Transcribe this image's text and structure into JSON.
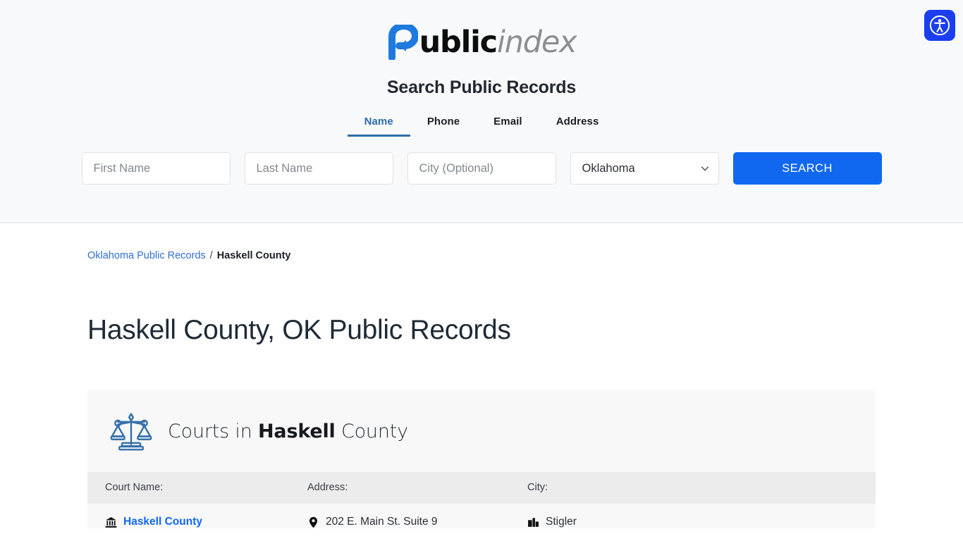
{
  "brand": {
    "name_bold": "ublic",
    "name_italic": "index",
    "logo_icon": "public-index-logo-mark",
    "accent_color": "#1168f0"
  },
  "accessibility": {
    "icon": "accessibility-person-icon",
    "label": "Accessibility options",
    "color": "#1a3ef0"
  },
  "search_panel": {
    "title": "Search Public Records",
    "tabs": [
      {
        "label": "Name",
        "active": true
      },
      {
        "label": "Phone",
        "active": false
      },
      {
        "label": "Email",
        "active": false
      },
      {
        "label": "Address",
        "active": false
      }
    ],
    "fields": {
      "first_name": {
        "placeholder": "First Name",
        "value": ""
      },
      "last_name": {
        "placeholder": "Last Name",
        "value": ""
      },
      "city": {
        "placeholder": "City (Optional)",
        "value": ""
      },
      "state": {
        "value": "Oklahoma",
        "options": [
          "Oklahoma"
        ],
        "chevron_icon": "chevron-down-icon"
      }
    },
    "search_button": "SEARCH"
  },
  "breadcrumb": {
    "parent": "Oklahoma Public Records",
    "separator": "/",
    "current": "Haskell County"
  },
  "page": {
    "title": "Haskell County, OK Public Records"
  },
  "courts_card": {
    "icon": "scales-of-justice-icon",
    "title_prefix": "Courts in ",
    "title_emphasis": "Haskell",
    "title_suffix": " County",
    "columns": [
      {
        "header": "Court Name:"
      },
      {
        "header": "Address:"
      },
      {
        "header": "City:"
      }
    ],
    "rows": [
      {
        "court_name": "Haskell County",
        "court_name_icon": "courthouse-icon",
        "address": "202 E. Main St. Suite 9",
        "address_icon": "map-pin-icon",
        "city": "Stigler",
        "city_icon": "city-buildings-icon"
      }
    ]
  }
}
